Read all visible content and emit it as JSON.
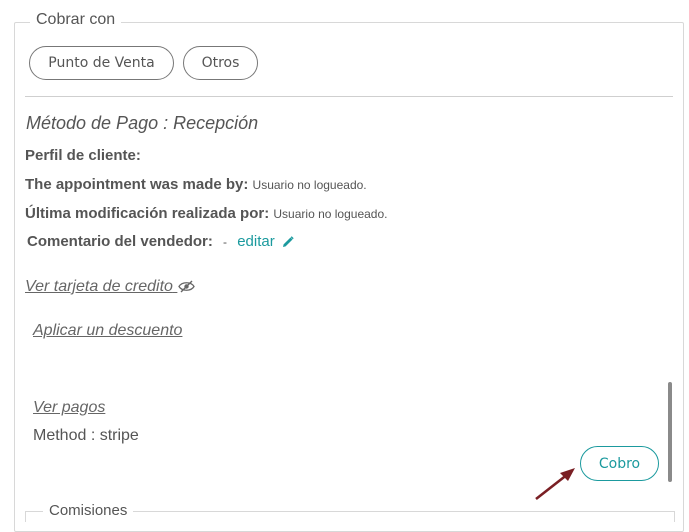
{
  "payment_section": {
    "legend": "Cobrar con",
    "buttons": {
      "punto_de_venta": "Punto de Venta",
      "otros": "Otros"
    }
  },
  "details": {
    "method_title": "Método de Pago : Recepción",
    "perfil_label": "Perfil de cliente:",
    "appointment_label": "The appointment was made by:",
    "appointment_value": "Usuario no logueado.",
    "modified_label": "Última modificación realizada por:",
    "modified_value": "Usuario no logueado.",
    "comment_label": "Comentario del vendedor:",
    "comment_value": "-",
    "edit_link": "editar"
  },
  "links": {
    "ver_tarjeta": "Ver tarjeta de credito",
    "aplicar_descuento": "Aplicar un descuento",
    "ver_pagos": "Ver pagos"
  },
  "payment_method": "Method : stripe",
  "cobro_button": "Cobro",
  "comisiones_legend": "Comisiones",
  "colors": {
    "accent": "#1b9a9e",
    "arrow": "#7a1f24"
  },
  "icons": {
    "edit": "pencil-icon",
    "view": "eye-slash-icon"
  }
}
